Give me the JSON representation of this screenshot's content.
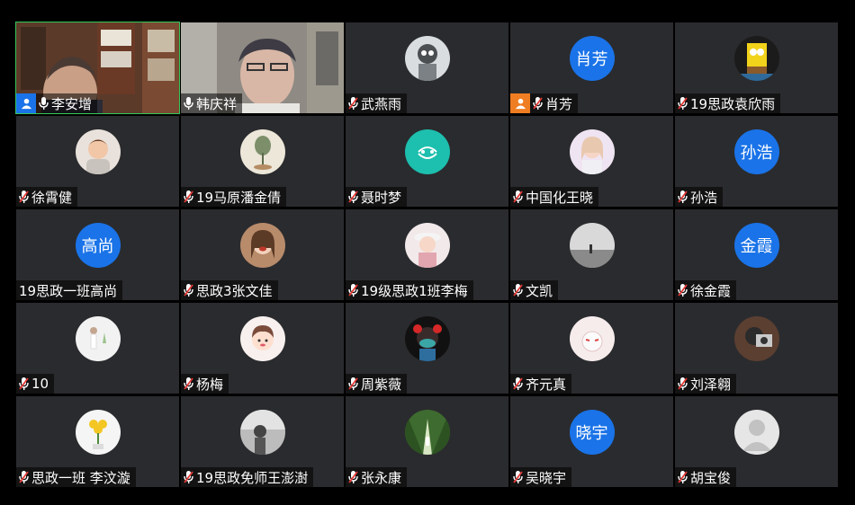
{
  "participants": [
    {
      "name": "李安增",
      "type": "video",
      "mic": "on",
      "host": "blue",
      "active": true
    },
    {
      "name": "韩庆祥",
      "type": "video",
      "mic": "on"
    },
    {
      "name": "武燕雨",
      "type": "image",
      "mic": "off",
      "avatar_icon": "cartoon-figure"
    },
    {
      "name": "肖芳",
      "type": "text",
      "avatar_text": "肖芳",
      "mic": "off",
      "host": "orange"
    },
    {
      "name": "19思政袁欣雨",
      "type": "image",
      "mic": "off",
      "avatar_icon": "spongebob"
    },
    {
      "name": "徐霄健",
      "type": "image",
      "mic": "off",
      "avatar_icon": "baby-photo"
    },
    {
      "name": "19马原潘金倩",
      "type": "image",
      "mic": "off",
      "avatar_icon": "plant-art"
    },
    {
      "name": "聂时梦",
      "type": "image",
      "mic": "off",
      "avatar_icon": "teal-logo"
    },
    {
      "name": "中国化王晓",
      "type": "image",
      "mic": "off",
      "avatar_icon": "girl-photo"
    },
    {
      "name": "孙浩",
      "type": "text",
      "avatar_text": "孙浩",
      "mic": "off"
    },
    {
      "name": "19思政一班高尚",
      "type": "text",
      "avatar_text": "高尚",
      "mic": "none"
    },
    {
      "name": "思政3张文佳",
      "type": "image",
      "mic": "off",
      "avatar_icon": "laughing-girl"
    },
    {
      "name": "19级思政1班李梅",
      "type": "image",
      "mic": "off",
      "avatar_icon": "girl-hat"
    },
    {
      "name": "文凯",
      "type": "image",
      "mic": "off",
      "avatar_icon": "grey-landscape"
    },
    {
      "name": "徐金霞",
      "type": "text",
      "avatar_text": "金霞",
      "mic": "off"
    },
    {
      "name": "10",
      "type": "image",
      "mic": "off",
      "avatar_icon": "white-figure"
    },
    {
      "name": "杨梅",
      "type": "image",
      "mic": "off",
      "avatar_icon": "cartoon-girl"
    },
    {
      "name": "周紫薇",
      "type": "image",
      "mic": "off",
      "avatar_icon": "masked-cartoon"
    },
    {
      "name": "齐元真",
      "type": "image",
      "mic": "off",
      "avatar_icon": "fox-mask"
    },
    {
      "name": "刘泽翱",
      "type": "image",
      "mic": "off",
      "avatar_icon": "camera-selfie"
    },
    {
      "name": "思政一班 李汶漩",
      "type": "image",
      "mic": "off",
      "avatar_icon": "yellow-flowers"
    },
    {
      "name": "19思政免师王澎澍",
      "type": "image",
      "mic": "off",
      "avatar_icon": "bw-photo"
    },
    {
      "name": "张永康",
      "type": "image",
      "mic": "off",
      "avatar_icon": "forest-path"
    },
    {
      "name": "吴晓宇",
      "type": "text",
      "avatar_text": "晓宇",
      "mic": "off"
    },
    {
      "name": "胡宝俊",
      "type": "image",
      "mic": "off",
      "avatar_icon": "default-user"
    }
  ],
  "colors": {
    "tile_bg": "#2a2b2e",
    "avatar_blue": "#1a73e8",
    "active_border": "#35c759",
    "mic_on": "#ffffff",
    "mic_off": "#e53935",
    "host_blue": "#1a73e8",
    "host_orange": "#ef7d22"
  }
}
